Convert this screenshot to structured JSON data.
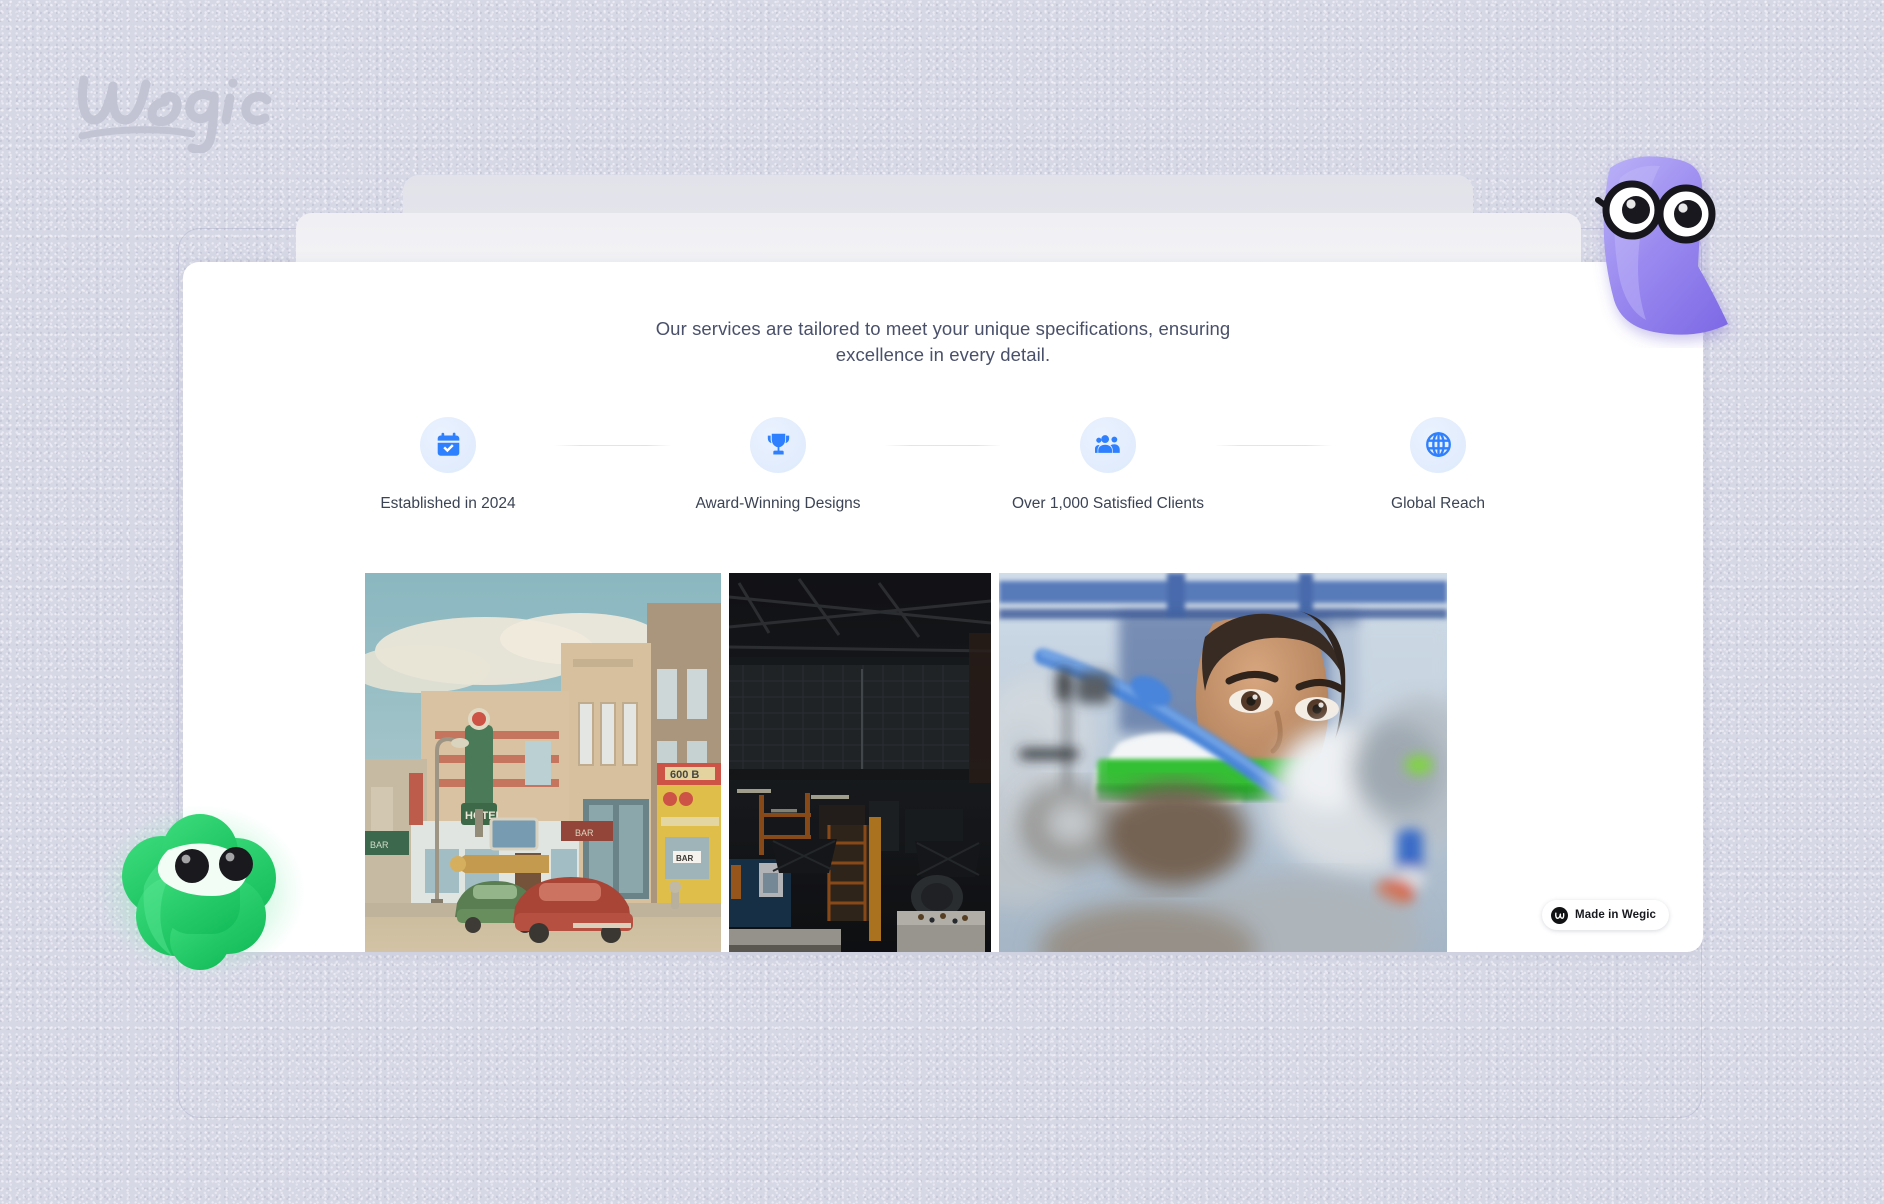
{
  "brand": {
    "wordmark": "wegic",
    "logo_icon": "wegic-script-logo"
  },
  "background": {
    "color": "#d7d8e6",
    "texture": "noise"
  },
  "site_preview": {
    "intro_text": "Our services are tailored to meet your unique specifications, ensuring excellence in every detail.",
    "features": [
      {
        "label": "Established in 2024",
        "icon": "calendar-check-icon",
        "icon_color": "#2f80ff"
      },
      {
        "label": "Award-Winning Designs",
        "icon": "trophy-icon",
        "icon_color": "#2f80ff"
      },
      {
        "label": "Over 1,000 Satisfied Clients",
        "icon": "people-group-icon",
        "icon_color": "#2f80ff"
      },
      {
        "label": "Global Reach",
        "icon": "globe-icon",
        "icon_color": "#2f80ff"
      }
    ],
    "gallery": [
      {
        "alt": "Vintage postcard illustration of a 1940s American main street with hotel neon sign and classic cars"
      },
      {
        "alt": "Dark industrial factory workshop interior with orange scaffolding and blue machinery"
      },
      {
        "alt": "Woman in a white lab coat inspecting laboratory equipment with blue tubing"
      }
    ],
    "badge": {
      "label": "Made in Wegic",
      "icon": "wegic-mark-icon"
    }
  },
  "mascots": [
    {
      "name": "purple-blob-with-glasses",
      "color": "#9b8bf0"
    },
    {
      "name": "green-cloud-blob",
      "color": "#25c765"
    }
  ]
}
